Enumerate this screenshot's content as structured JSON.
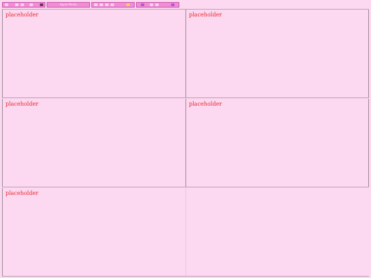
{
  "toolbar": {
    "groups": [
      {
        "id": "group-1",
        "icons": [
          "heart-icon",
          "dot-icon",
          "dot-icon",
          "dot-icon",
          "flower-icon"
        ]
      },
      {
        "id": "group-2",
        "label": "Apple Plenty"
      },
      {
        "id": "group-3",
        "icons": [
          "dot-icon",
          "dot-icon",
          "dot-icon",
          "dot-icon",
          "star-icon"
        ]
      },
      {
        "id": "group-4",
        "icons": [
          "flower-icon",
          "dot-icon",
          "dot-icon",
          "dash-icon"
        ]
      }
    ]
  },
  "panels": [
    {
      "label": "placeholder"
    },
    {
      "label": "placeholder"
    },
    {
      "label": "placeholder"
    },
    {
      "label": "placeholder"
    },
    {
      "label": "placeholder"
    },
    {
      "label": ""
    }
  ],
  "colors": {
    "background": "#fcd9f1",
    "toolbar_fill": "#f48bd6",
    "placeholder_text": "#e8262c"
  }
}
